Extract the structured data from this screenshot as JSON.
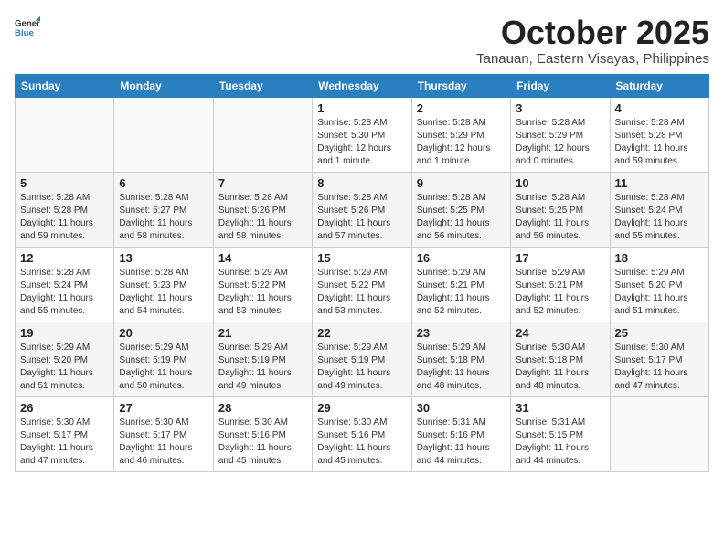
{
  "header": {
    "logo_general": "General",
    "logo_blue": "Blue",
    "month_title": "October 2025",
    "location": "Tanauan, Eastern Visayas, Philippines"
  },
  "weekdays": [
    "Sunday",
    "Monday",
    "Tuesday",
    "Wednesday",
    "Thursday",
    "Friday",
    "Saturday"
  ],
  "weeks": [
    [
      {
        "day": "",
        "info": ""
      },
      {
        "day": "",
        "info": ""
      },
      {
        "day": "",
        "info": ""
      },
      {
        "day": "1",
        "info": "Sunrise: 5:28 AM\nSunset: 5:30 PM\nDaylight: 12 hours\nand 1 minute."
      },
      {
        "day": "2",
        "info": "Sunrise: 5:28 AM\nSunset: 5:29 PM\nDaylight: 12 hours\nand 1 minute."
      },
      {
        "day": "3",
        "info": "Sunrise: 5:28 AM\nSunset: 5:29 PM\nDaylight: 12 hours\nand 0 minutes."
      },
      {
        "day": "4",
        "info": "Sunrise: 5:28 AM\nSunset: 5:28 PM\nDaylight: 11 hours\nand 59 minutes."
      }
    ],
    [
      {
        "day": "5",
        "info": "Sunrise: 5:28 AM\nSunset: 5:28 PM\nDaylight: 11 hours\nand 59 minutes."
      },
      {
        "day": "6",
        "info": "Sunrise: 5:28 AM\nSunset: 5:27 PM\nDaylight: 11 hours\nand 58 minutes."
      },
      {
        "day": "7",
        "info": "Sunrise: 5:28 AM\nSunset: 5:26 PM\nDaylight: 11 hours\nand 58 minutes."
      },
      {
        "day": "8",
        "info": "Sunrise: 5:28 AM\nSunset: 5:26 PM\nDaylight: 11 hours\nand 57 minutes."
      },
      {
        "day": "9",
        "info": "Sunrise: 5:28 AM\nSunset: 5:25 PM\nDaylight: 11 hours\nand 56 minutes."
      },
      {
        "day": "10",
        "info": "Sunrise: 5:28 AM\nSunset: 5:25 PM\nDaylight: 11 hours\nand 56 minutes."
      },
      {
        "day": "11",
        "info": "Sunrise: 5:28 AM\nSunset: 5:24 PM\nDaylight: 11 hours\nand 55 minutes."
      }
    ],
    [
      {
        "day": "12",
        "info": "Sunrise: 5:28 AM\nSunset: 5:24 PM\nDaylight: 11 hours\nand 55 minutes."
      },
      {
        "day": "13",
        "info": "Sunrise: 5:28 AM\nSunset: 5:23 PM\nDaylight: 11 hours\nand 54 minutes."
      },
      {
        "day": "14",
        "info": "Sunrise: 5:29 AM\nSunset: 5:22 PM\nDaylight: 11 hours\nand 53 minutes."
      },
      {
        "day": "15",
        "info": "Sunrise: 5:29 AM\nSunset: 5:22 PM\nDaylight: 11 hours\nand 53 minutes."
      },
      {
        "day": "16",
        "info": "Sunrise: 5:29 AM\nSunset: 5:21 PM\nDaylight: 11 hours\nand 52 minutes."
      },
      {
        "day": "17",
        "info": "Sunrise: 5:29 AM\nSunset: 5:21 PM\nDaylight: 11 hours\nand 52 minutes."
      },
      {
        "day": "18",
        "info": "Sunrise: 5:29 AM\nSunset: 5:20 PM\nDaylight: 11 hours\nand 51 minutes."
      }
    ],
    [
      {
        "day": "19",
        "info": "Sunrise: 5:29 AM\nSunset: 5:20 PM\nDaylight: 11 hours\nand 51 minutes."
      },
      {
        "day": "20",
        "info": "Sunrise: 5:29 AM\nSunset: 5:19 PM\nDaylight: 11 hours\nand 50 minutes."
      },
      {
        "day": "21",
        "info": "Sunrise: 5:29 AM\nSunset: 5:19 PM\nDaylight: 11 hours\nand 49 minutes."
      },
      {
        "day": "22",
        "info": "Sunrise: 5:29 AM\nSunset: 5:19 PM\nDaylight: 11 hours\nand 49 minutes."
      },
      {
        "day": "23",
        "info": "Sunrise: 5:29 AM\nSunset: 5:18 PM\nDaylight: 11 hours\nand 48 minutes."
      },
      {
        "day": "24",
        "info": "Sunrise: 5:30 AM\nSunset: 5:18 PM\nDaylight: 11 hours\nand 48 minutes."
      },
      {
        "day": "25",
        "info": "Sunrise: 5:30 AM\nSunset: 5:17 PM\nDaylight: 11 hours\nand 47 minutes."
      }
    ],
    [
      {
        "day": "26",
        "info": "Sunrise: 5:30 AM\nSunset: 5:17 PM\nDaylight: 11 hours\nand 47 minutes."
      },
      {
        "day": "27",
        "info": "Sunrise: 5:30 AM\nSunset: 5:17 PM\nDaylight: 11 hours\nand 46 minutes."
      },
      {
        "day": "28",
        "info": "Sunrise: 5:30 AM\nSunset: 5:16 PM\nDaylight: 11 hours\nand 45 minutes."
      },
      {
        "day": "29",
        "info": "Sunrise: 5:30 AM\nSunset: 5:16 PM\nDaylight: 11 hours\nand 45 minutes."
      },
      {
        "day": "30",
        "info": "Sunrise: 5:31 AM\nSunset: 5:16 PM\nDaylight: 11 hours\nand 44 minutes."
      },
      {
        "day": "31",
        "info": "Sunrise: 5:31 AM\nSunset: 5:15 PM\nDaylight: 11 hours\nand 44 minutes."
      },
      {
        "day": "",
        "info": ""
      }
    ]
  ]
}
